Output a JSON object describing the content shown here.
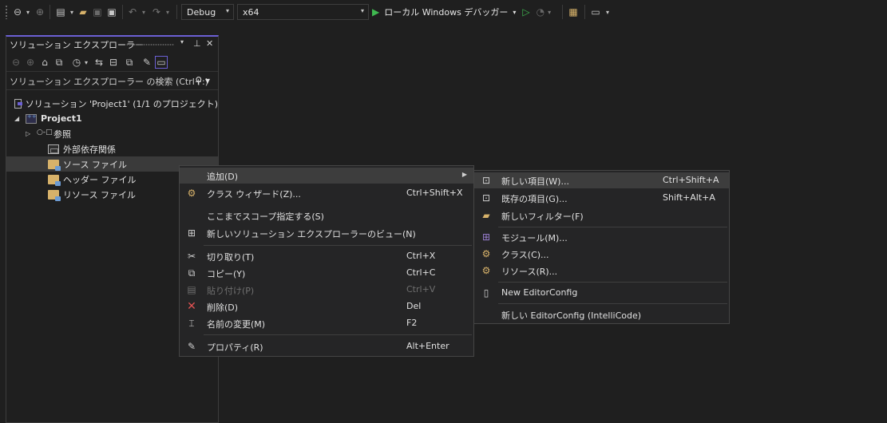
{
  "toolbar": {
    "config": "Debug",
    "platform": "x64",
    "debugger_label": "ローカル Windows デバッガー",
    "play_color": "#3fb950"
  },
  "solution_explorer": {
    "title": "ソリューション エクスプローラー",
    "search_placeholder": "ソリューション エクスプローラー の検索 (Ctrl+:)",
    "accent": "#6b5fd3",
    "tree": [
      {
        "label": "ソリューション 'Project1' (1/1 のプロジェクト)"
      },
      {
        "label": "Project1"
      },
      {
        "label": "参照"
      },
      {
        "label": "外部依存関係"
      },
      {
        "label": "ソース ファイル"
      },
      {
        "label": "ヘッダー ファイル"
      },
      {
        "label": "リソース ファイル"
      }
    ]
  },
  "context_menu": {
    "items": [
      {
        "label": "追加(D)",
        "shortcut": ""
      },
      {
        "label": "クラス ウィザード(Z)...",
        "shortcut": "Ctrl+Shift+X"
      },
      {
        "label": "ここまでスコープ指定する(S)",
        "shortcut": ""
      },
      {
        "label": "新しいソリューション エクスプローラーのビュー(N)",
        "shortcut": ""
      },
      {
        "label": "切り取り(T)",
        "shortcut": "Ctrl+X"
      },
      {
        "label": "コピー(Y)",
        "shortcut": "Ctrl+C"
      },
      {
        "label": "貼り付け(P)",
        "shortcut": "Ctrl+V"
      },
      {
        "label": "削除(D)",
        "shortcut": "Del"
      },
      {
        "label": "名前の変更(M)",
        "shortcut": "F2"
      },
      {
        "label": "プロパティ(R)",
        "shortcut": "Alt+Enter"
      }
    ]
  },
  "submenu": {
    "items": [
      {
        "label": "新しい項目(W)...",
        "shortcut": "Ctrl+Shift+A"
      },
      {
        "label": "既存の項目(G)...",
        "shortcut": "Shift+Alt+A"
      },
      {
        "label": "新しいフィルター(F)",
        "shortcut": ""
      },
      {
        "label": "モジュール(M)...",
        "shortcut": ""
      },
      {
        "label": "クラス(C)...",
        "shortcut": ""
      },
      {
        "label": "リソース(R)...",
        "shortcut": ""
      },
      {
        "label": "New EditorConfig",
        "shortcut": ""
      },
      {
        "label": "新しい EditorConfig (IntelliCode)",
        "shortcut": ""
      }
    ]
  }
}
